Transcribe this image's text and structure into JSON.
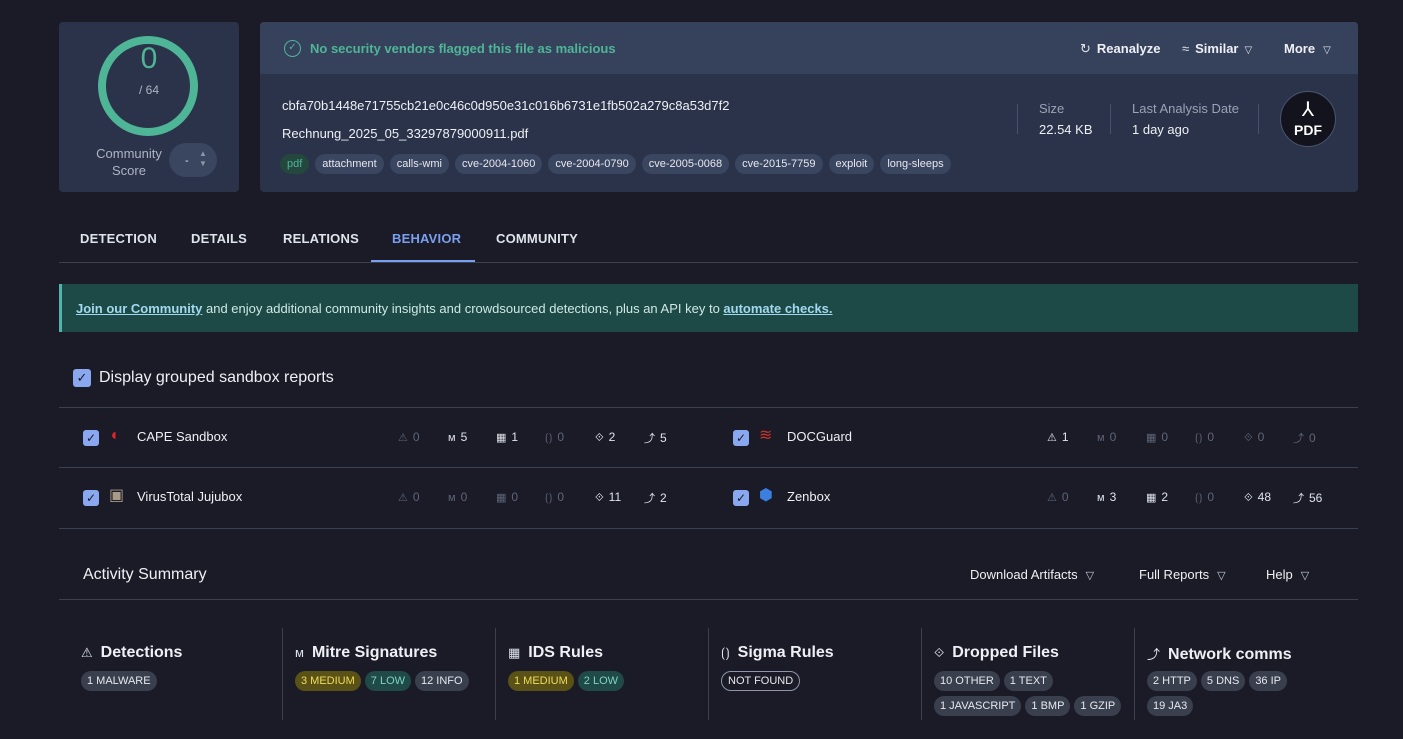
{
  "score": {
    "detected": "0",
    "total": "/ 64",
    "community_label": "Community Score",
    "vote_value": "-"
  },
  "file": {
    "status_text": "No security vendors flagged this file as malicious",
    "actions": {
      "reanalyze": "Reanalyze",
      "similar": "Similar",
      "more": "More"
    },
    "hash": "cbfa70b1448e71755cb21e0c46c0d950e31c016b6731e1fb502a279c8a53d7f2",
    "name": "Rechnung_2025_05_33297879000911.pdf",
    "tags": [
      "pdf",
      "attachment",
      "calls-wmi",
      "cve-2004-1060",
      "cve-2004-0790",
      "cve-2005-0068",
      "cve-2015-7759",
      "exploit",
      "long-sleeps"
    ],
    "size_label": "Size",
    "size_value": "22.54 KB",
    "date_label": "Last Analysis Date",
    "date_value": "1 day ago",
    "type_badge": "PDF"
  },
  "tabs": [
    "DETECTION",
    "DETAILS",
    "RELATIONS",
    "BEHAVIOR",
    "COMMUNITY"
  ],
  "active_tab": "BEHAVIOR",
  "banner": {
    "link1": "Join our Community",
    "middle": " and enjoy additional community insights and crowdsourced detections, plus an API key to ",
    "link2": "automate checks."
  },
  "grouped_label": "Display grouped sandbox reports",
  "sandboxes": [
    {
      "name": "CAPE Sandbox",
      "stats": [
        "0",
        "5",
        "1",
        "0",
        "2",
        "5"
      ]
    },
    {
      "name": "DOCGuard",
      "stats": [
        "1",
        "0",
        "0",
        "0",
        "0",
        "0"
      ]
    },
    {
      "name": "VirusTotal Jujubox",
      "stats": [
        "0",
        "0",
        "0",
        "0",
        "11",
        "2"
      ]
    },
    {
      "name": "Zenbox",
      "stats": [
        "0",
        "3",
        "2",
        "0",
        "48",
        "56"
      ]
    }
  ],
  "activity": {
    "title": "Activity Summary",
    "menus": [
      "Download Artifacts",
      "Full Reports",
      "Help"
    ],
    "columns": [
      {
        "title": "Detections",
        "rows": [
          [
            {
              "t": "1 MALWARE",
              "k": "gray"
            }
          ]
        ]
      },
      {
        "title": "Mitre Signatures",
        "rows": [
          [
            {
              "t": "3 MEDIUM",
              "k": "med"
            },
            {
              "t": "7 LOW",
              "k": "low"
            },
            {
              "t": "12 INFO",
              "k": "gray"
            }
          ]
        ]
      },
      {
        "title": "IDS Rules",
        "rows": [
          [
            {
              "t": "1 MEDIUM",
              "k": "med"
            },
            {
              "t": "2 LOW",
              "k": "low"
            }
          ]
        ]
      },
      {
        "title": "Sigma Rules",
        "rows": [
          [
            {
              "t": "NOT FOUND",
              "k": "outline"
            }
          ]
        ]
      },
      {
        "title": "Dropped Files",
        "rows": [
          [
            {
              "t": "10 OTHER",
              "k": "gray"
            },
            {
              "t": "1 TEXT",
              "k": "gray"
            }
          ],
          [
            {
              "t": "1 JAVASCRIPT",
              "k": "gray"
            },
            {
              "t": "1 BMP",
              "k": "gray"
            },
            {
              "t": "1 GZIP",
              "k": "gray"
            }
          ]
        ]
      },
      {
        "title": "Network comms",
        "rows": [
          [
            {
              "t": "2 HTTP",
              "k": "gray"
            },
            {
              "t": "5 DNS",
              "k": "gray"
            },
            {
              "t": "36 IP",
              "k": "gray"
            }
          ],
          [
            {
              "t": "19 JA3",
              "k": "gray"
            }
          ]
        ]
      }
    ]
  },
  "colors": {
    "accent": "#7b9ff0",
    "clean": "#4fb597",
    "card": "#2a3349",
    "background": "#1a1b26"
  }
}
